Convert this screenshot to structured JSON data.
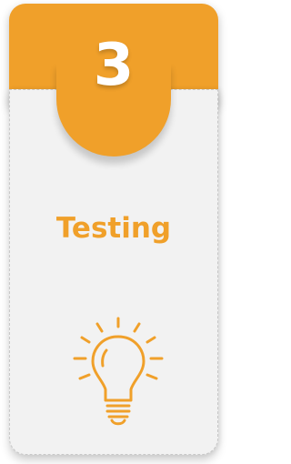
{
  "card": {
    "number": "3",
    "title": "Testing",
    "icon": "lightbulb-icon",
    "accent_color": "#f0a02a",
    "panel_color": "#f2f2f2"
  }
}
